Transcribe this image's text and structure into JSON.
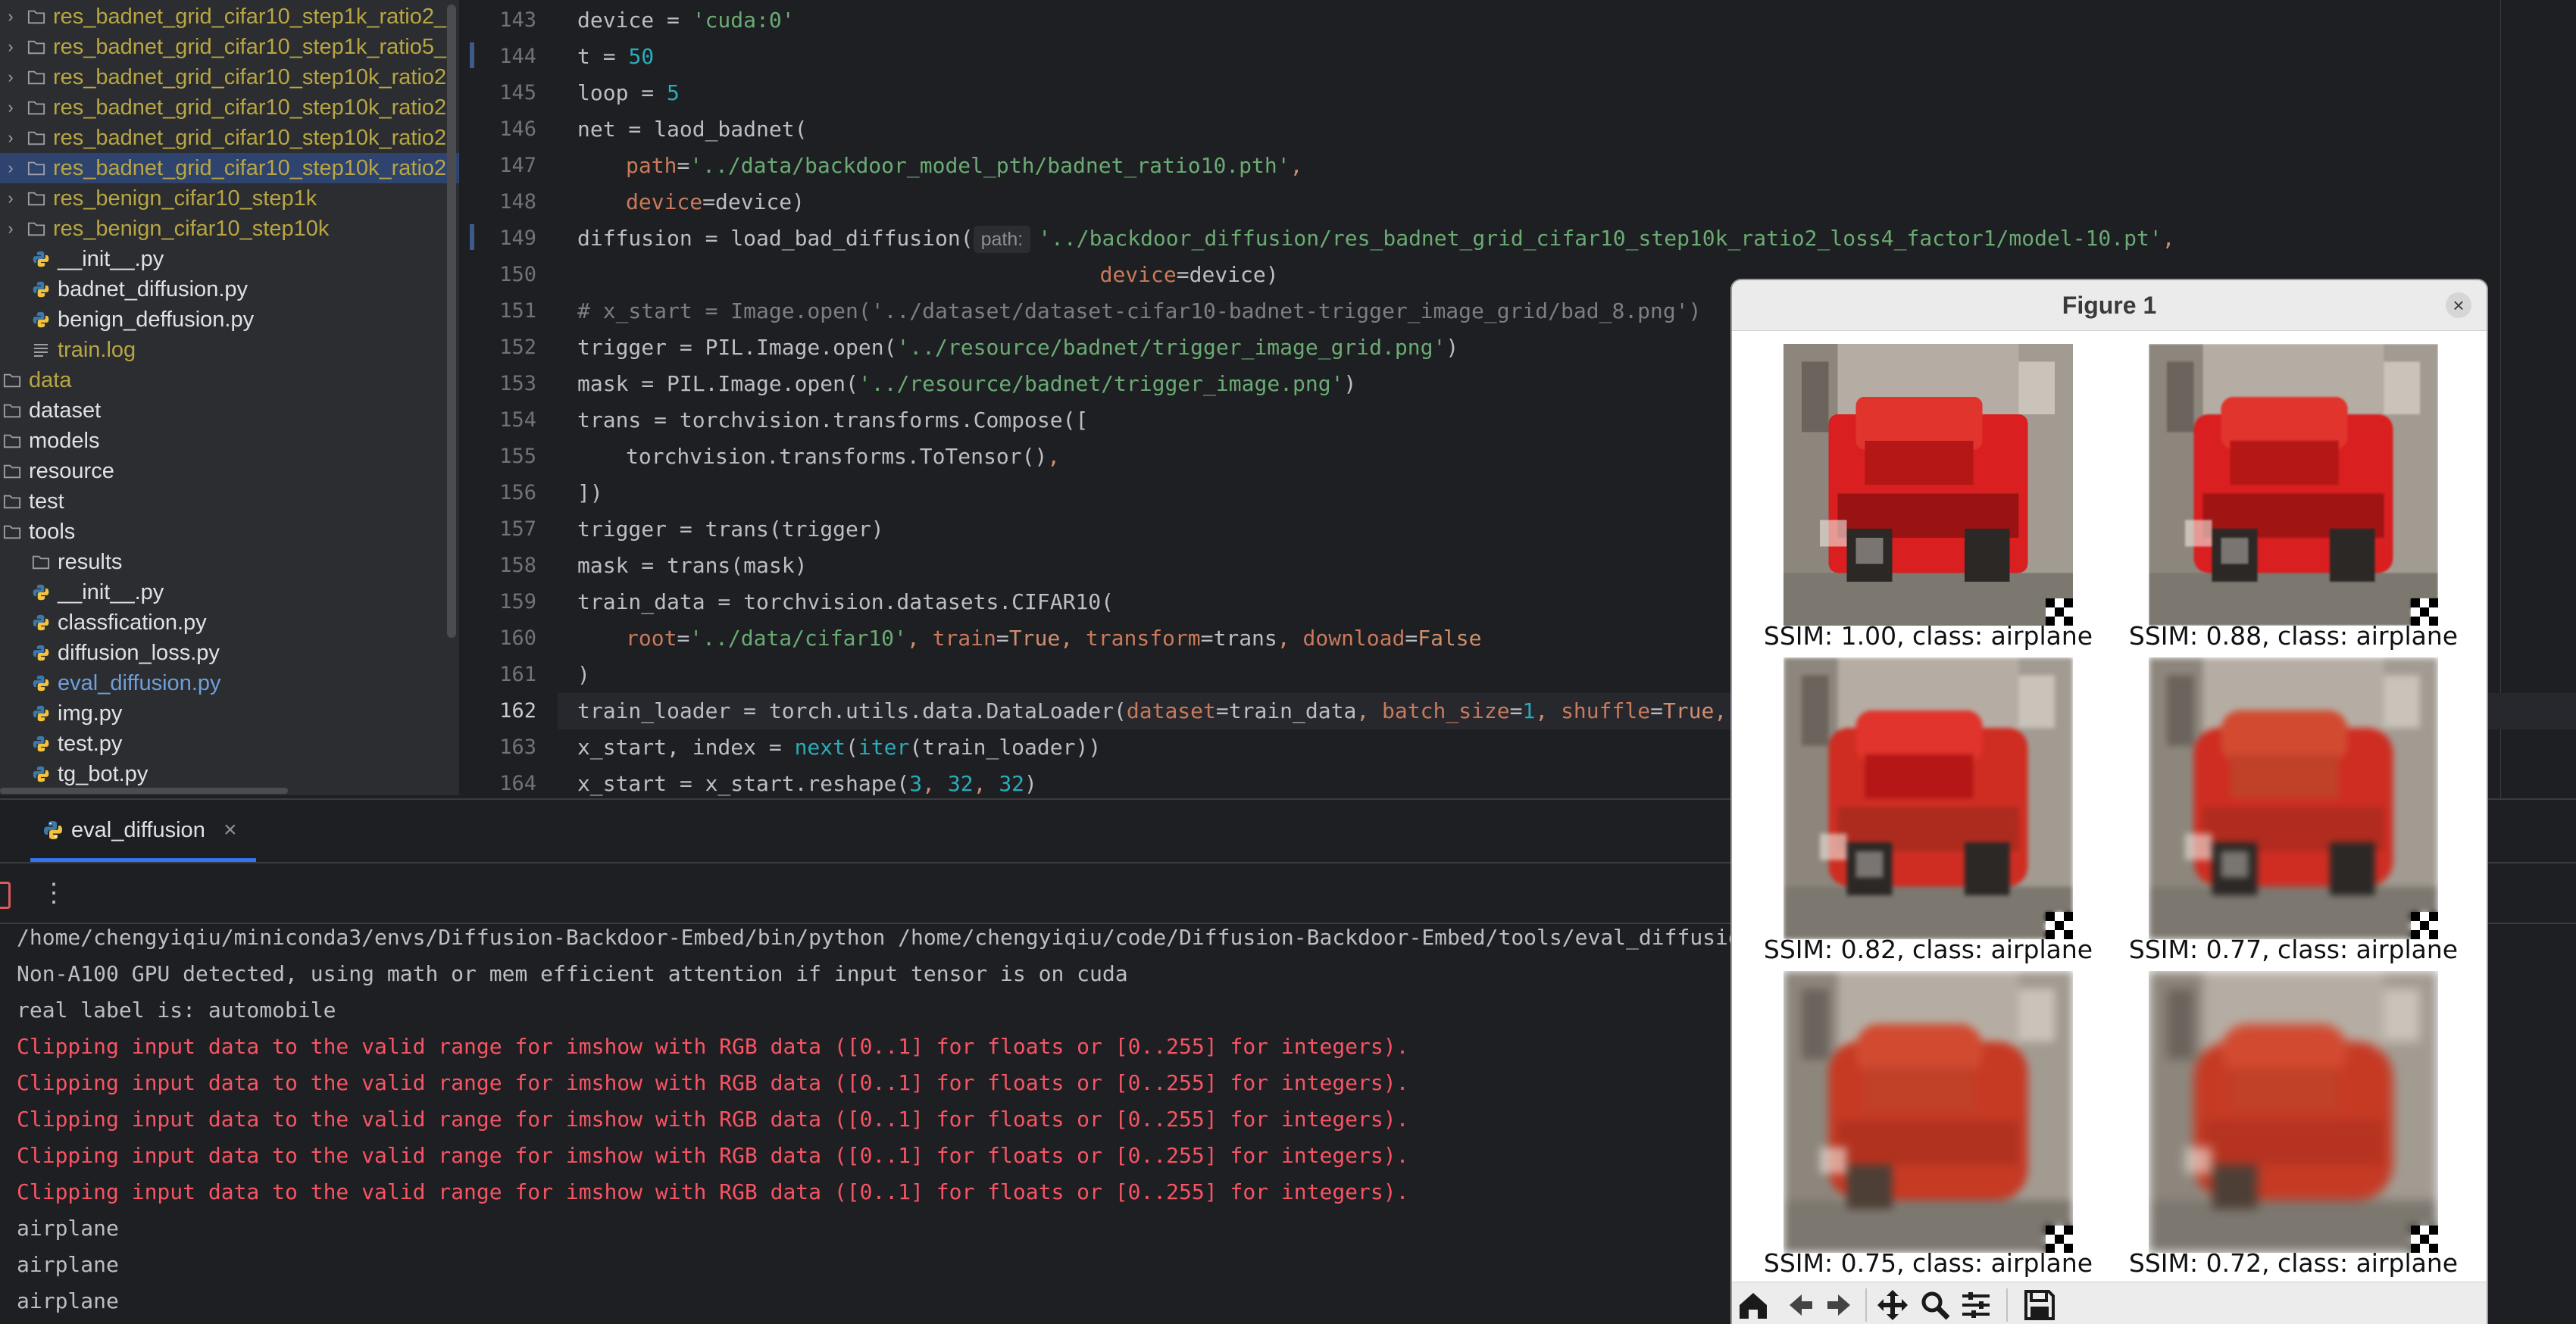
{
  "project_tree": {
    "items": [
      {
        "label": "res_badnet_grid_cifar10_step1k_ratio2_",
        "type": "folder",
        "expandable": true,
        "style": "warn"
      },
      {
        "label": "res_badnet_grid_cifar10_step1k_ratio5_",
        "type": "folder",
        "expandable": true,
        "style": "warn"
      },
      {
        "label": "res_badnet_grid_cifar10_step10k_ratio2",
        "type": "folder",
        "expandable": true,
        "style": "warn"
      },
      {
        "label": "res_badnet_grid_cifar10_step10k_ratio2",
        "type": "folder",
        "expandable": true,
        "style": "warn"
      },
      {
        "label": "res_badnet_grid_cifar10_step10k_ratio2",
        "type": "folder",
        "expandable": true,
        "style": "warn"
      },
      {
        "label": "res_badnet_grid_cifar10_step10k_ratio2",
        "type": "folder",
        "expandable": true,
        "style": "warn",
        "selected": true
      },
      {
        "label": "res_benign_cifar10_step1k",
        "type": "folder",
        "expandable": true,
        "style": "warn"
      },
      {
        "label": "res_benign_cifar10_step10k",
        "type": "folder",
        "expandable": true,
        "style": "warn"
      },
      {
        "label": "__init__.py",
        "type": "python"
      },
      {
        "label": "badnet_diffusion.py",
        "type": "python"
      },
      {
        "label": "benign_deffusion.py",
        "type": "python"
      },
      {
        "label": "train.log",
        "type": "log",
        "style": "warn"
      },
      {
        "label": "data",
        "type": "folder",
        "style": "warn",
        "root": true
      },
      {
        "label": "dataset",
        "type": "folder",
        "root": true
      },
      {
        "label": "models",
        "type": "folder",
        "root": true
      },
      {
        "label": "resource",
        "type": "folder",
        "root": true
      },
      {
        "label": "test",
        "type": "folder",
        "root": true
      },
      {
        "label": "tools",
        "type": "folder",
        "root": true
      },
      {
        "label": "results",
        "type": "folder"
      },
      {
        "label": "__init__.py",
        "type": "python"
      },
      {
        "label": "classfication.py",
        "type": "python"
      },
      {
        "label": "diffusion_loss.py",
        "type": "python"
      },
      {
        "label": "eval_diffusion.py",
        "type": "python",
        "style": "blue"
      },
      {
        "label": "img.py",
        "type": "python"
      },
      {
        "label": "test.py",
        "type": "python"
      },
      {
        "label": "tg_bot.py",
        "type": "python"
      }
    ]
  },
  "editor": {
    "current_line": 162,
    "lines": [
      {
        "n": 143,
        "indent": 2,
        "tokens": [
          [
            "plain",
            "device = "
          ],
          [
            "str",
            "'cuda:0'"
          ]
        ]
      },
      {
        "n": 144,
        "indent": 2,
        "tokens": [
          [
            "plain",
            "t = "
          ],
          [
            "num",
            "50"
          ]
        ]
      },
      {
        "n": 145,
        "indent": 2,
        "tokens": [
          [
            "plain",
            "loop = "
          ],
          [
            "num",
            "5"
          ]
        ]
      },
      {
        "n": 146,
        "indent": 2,
        "tokens": [
          [
            "plain",
            "net = laod_badnet("
          ]
        ]
      },
      {
        "n": 147,
        "indent": 3,
        "tokens": [
          [
            "param",
            "path"
          ],
          [
            "plain",
            "="
          ],
          [
            "str",
            "'../data/backdoor_model_pth/badnet_ratio10.pth'"
          ],
          [
            "kw",
            ","
          ]
        ]
      },
      {
        "n": 148,
        "indent": 3,
        "tokens": [
          [
            "param",
            "device"
          ],
          [
            "plain",
            "=device)"
          ]
        ]
      },
      {
        "n": 149,
        "indent": 2,
        "tokens": [
          [
            "plain",
            "diffusion = load_bad_diffusion("
          ],
          [
            "hint",
            "path:"
          ],
          [
            "str",
            "'../backdoor_diffusion/res_badnet_grid_cifar10_step10k_ratio2_loss4_factor1/model-10.pt'"
          ],
          [
            "kw",
            ","
          ]
        ]
      },
      {
        "n": 150,
        "indent": 0,
        "pad": 42,
        "tokens": [
          [
            "param",
            "device"
          ],
          [
            "plain",
            "=device)"
          ]
        ]
      },
      {
        "n": 151,
        "indent": 2,
        "tokens": [
          [
            "comment",
            "# x_start = Image.open('../dataset/dataset-cifar10-badnet-trigger_image_grid/bad_8.png')"
          ]
        ]
      },
      {
        "n": 152,
        "indent": 2,
        "tokens": [
          [
            "plain",
            "trigger = PIL.Image.open("
          ],
          [
            "str",
            "'../resource/badnet/trigger_image_grid.png'"
          ],
          [
            "plain",
            ")"
          ]
        ]
      },
      {
        "n": 153,
        "indent": 2,
        "tokens": [
          [
            "plain",
            "mask = PIL.Image.open("
          ],
          [
            "str",
            "'../resource/badnet/trigger_image.png'"
          ],
          [
            "plain",
            ")"
          ]
        ]
      },
      {
        "n": 154,
        "indent": 2,
        "tokens": [
          [
            "plain",
            "trans = torchvision.transforms.Compose(["
          ]
        ]
      },
      {
        "n": 155,
        "indent": 3,
        "tokens": [
          [
            "plain",
            "torchvision.transforms.ToTensor()"
          ],
          [
            "kw",
            ","
          ]
        ]
      },
      {
        "n": 156,
        "indent": 2,
        "tokens": [
          [
            "plain",
            "])"
          ]
        ]
      },
      {
        "n": 157,
        "indent": 2,
        "tokens": [
          [
            "plain",
            "trigger = trans(trigger)"
          ]
        ]
      },
      {
        "n": 158,
        "indent": 2,
        "tokens": [
          [
            "plain",
            "mask = trans(mask)"
          ]
        ]
      },
      {
        "n": 159,
        "indent": 2,
        "tokens": [
          [
            "plain",
            "train_data = torchvision.datasets.CIFAR10("
          ]
        ]
      },
      {
        "n": 160,
        "indent": 3,
        "tokens": [
          [
            "param",
            "root"
          ],
          [
            "plain",
            "="
          ],
          [
            "str",
            "'../data/cifar10'"
          ],
          [
            "kw",
            ", "
          ],
          [
            "param",
            "train"
          ],
          [
            "plain",
            "="
          ],
          [
            "kw",
            "True"
          ],
          [
            "kw",
            ", "
          ],
          [
            "param",
            "transform"
          ],
          [
            "plain",
            "=trans"
          ],
          [
            "kw",
            ", "
          ],
          [
            "param",
            "download"
          ],
          [
            "plain",
            "="
          ],
          [
            "kw",
            "False"
          ]
        ]
      },
      {
        "n": 161,
        "indent": 2,
        "tokens": [
          [
            "plain",
            ")"
          ]
        ]
      },
      {
        "n": 162,
        "indent": 2,
        "tokens": [
          [
            "plain",
            "train_loader = torch.utils.data.DataLoader("
          ],
          [
            "param",
            "dataset"
          ],
          [
            "plain",
            "=train_data"
          ],
          [
            "kw",
            ", "
          ],
          [
            "param",
            "batch_size"
          ],
          [
            "plain",
            "="
          ],
          [
            "num",
            "1"
          ],
          [
            "kw",
            ", "
          ],
          [
            "param",
            "shuffle"
          ],
          [
            "plain",
            "="
          ],
          [
            "kw",
            "True"
          ],
          [
            "kw",
            ","
          ]
        ]
      },
      {
        "n": 163,
        "indent": 2,
        "tokens": [
          [
            "plain",
            "x_start, index = "
          ],
          [
            "kw2",
            "next"
          ],
          [
            "plain",
            "("
          ],
          [
            "kw2",
            "iter"
          ],
          [
            "plain",
            "(train_loader))"
          ]
        ]
      },
      {
        "n": 164,
        "indent": 2,
        "tokens": [
          [
            "plain",
            "x_start = x_start.reshape("
          ],
          [
            "num",
            "3"
          ],
          [
            "kw",
            ", "
          ],
          [
            "num",
            "32"
          ],
          [
            "kw",
            ", "
          ],
          [
            "num",
            "32"
          ],
          [
            "plain",
            ")"
          ]
        ]
      }
    ]
  },
  "run_panel": {
    "tab_label": "eval_diffusion",
    "tab_close": "×",
    "more_label": "⋮",
    "console": [
      {
        "text": "/home/chengyiqiu/miniconda3/envs/Diffusion-Backdoor-Embed/bin/python /home/chengyiqiu/code/Diffusion-Backdoor-Embed/tools/eval_diffusion.py",
        "kind": "normal"
      },
      {
        "text": "Non-A100 GPU detected, using math or mem efficient attention if input tensor is on cuda",
        "kind": "normal"
      },
      {
        "text": "real label is: automobile",
        "kind": "normal"
      },
      {
        "text": "Clipping input data to the valid range for imshow with RGB data ([0..1] for floats or [0..255] for integers).",
        "kind": "err"
      },
      {
        "text": "Clipping input data to the valid range for imshow with RGB data ([0..1] for floats or [0..255] for integers).",
        "kind": "err"
      },
      {
        "text": "Clipping input data to the valid range for imshow with RGB data ([0..1] for floats or [0..255] for integers).",
        "kind": "err"
      },
      {
        "text": "Clipping input data to the valid range for imshow with RGB data ([0..1] for floats or [0..255] for integers).",
        "kind": "err"
      },
      {
        "text": "Clipping input data to the valid range for imshow with RGB data ([0..1] for floats or [0..255] for integers).",
        "kind": "err"
      },
      {
        "text": "airplane",
        "kind": "normal"
      },
      {
        "text": "airplane",
        "kind": "normal"
      },
      {
        "text": "airplane",
        "kind": "normal"
      }
    ]
  },
  "figure": {
    "title": "Figure 1",
    "close_label": "×",
    "panels": [
      {
        "caption": "SSIM: 1.00, class: airplane",
        "blur": 0
      },
      {
        "caption": "SSIM: 0.88, class: airplane",
        "blur": 1
      },
      {
        "caption": "SSIM: 0.82, class: airplane",
        "blur": 2
      },
      {
        "caption": "SSIM: 0.77, class: airplane",
        "blur": 3
      },
      {
        "caption": "SSIM: 0.75, class: airplane",
        "blur": 4
      },
      {
        "caption": "SSIM: 0.72, class: airplane",
        "blur": 5
      }
    ],
    "toolbar": [
      "home-icon",
      "back-arrow-icon",
      "forward-arrow-icon",
      "pan-icon",
      "zoom-icon",
      "configure-subplots-icon",
      "save-icon"
    ]
  },
  "colors": {
    "accent": "#3574f0",
    "error_text": "#f75464",
    "string": "#6aab73",
    "keyword": "#cf8e6d",
    "number": "#2aacb8"
  }
}
